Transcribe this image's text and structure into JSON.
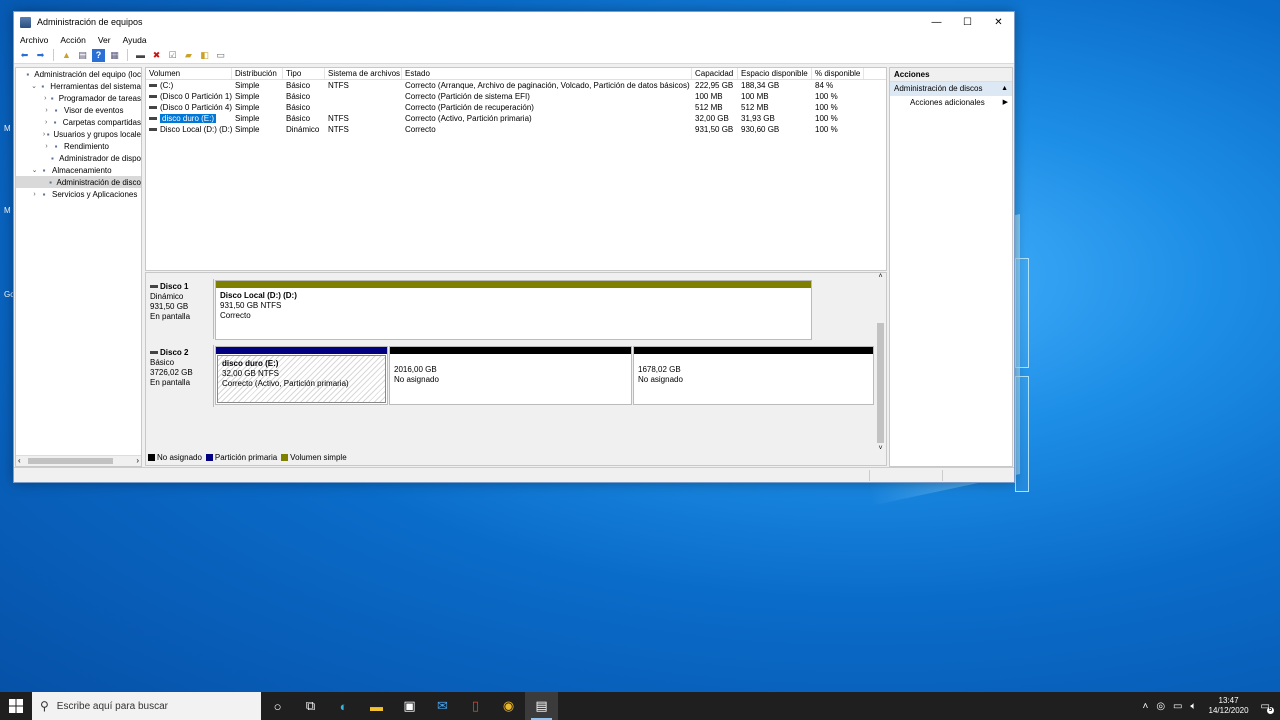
{
  "window": {
    "title": "Administración de equipos",
    "controls": {
      "minimize": "—",
      "maximize": "☐",
      "close": "✕"
    }
  },
  "menu": [
    "Archivo",
    "Acción",
    "Ver",
    "Ayuda"
  ],
  "tree": [
    {
      "label": "Administración del equipo (loc",
      "twisty": "",
      "level": 0,
      "icon": "computer-icon"
    },
    {
      "label": "Herramientas del sistema",
      "twisty": "⌄",
      "level": 1,
      "icon": "tools-icon"
    },
    {
      "label": "Programador de tareas",
      "twisty": "›",
      "level": 2,
      "icon": "clock-icon"
    },
    {
      "label": "Visor de eventos",
      "twisty": "›",
      "level": 2,
      "icon": "event-viewer-icon"
    },
    {
      "label": "Carpetas compartidas",
      "twisty": "›",
      "level": 2,
      "icon": "shared-folder-icon"
    },
    {
      "label": "Usuarios y grupos locale",
      "twisty": "›",
      "level": 2,
      "icon": "users-icon"
    },
    {
      "label": "Rendimiento",
      "twisty": "›",
      "level": 2,
      "icon": "performance-icon"
    },
    {
      "label": "Administrador de dispo",
      "twisty": "",
      "level": 2,
      "icon": "device-manager-icon"
    },
    {
      "label": "Almacenamiento",
      "twisty": "⌄",
      "level": 1,
      "icon": "storage-icon"
    },
    {
      "label": "Administración de disco",
      "twisty": "",
      "level": 2,
      "icon": "disk-icon",
      "selected": true
    },
    {
      "label": "Servicios y Aplicaciones",
      "twisty": "›",
      "level": 1,
      "icon": "services-icon"
    }
  ],
  "volumes": {
    "headers": [
      "Volumen",
      "Distribución",
      "Tipo",
      "Sistema de archivos",
      "Estado",
      "Capacidad",
      "Espacio disponible",
      "% disponible"
    ],
    "rows": [
      [
        "(C:)",
        "Simple",
        "Básico",
        "NTFS",
        "Correcto (Arranque, Archivo de paginación, Volcado, Partición de datos básicos)",
        "222,95 GB",
        "188,34 GB",
        "84 %"
      ],
      [
        "(Disco 0 Partición 1)",
        "Simple",
        "Básico",
        "",
        "Correcto (Partición de sistema EFI)",
        "100 MB",
        "100 MB",
        "100 %"
      ],
      [
        "(Disco 0 Partición 4)",
        "Simple",
        "Básico",
        "",
        "Correcto (Partición de recuperación)",
        "512 MB",
        "512 MB",
        "100 %"
      ],
      [
        "disco duro (E:)",
        "Simple",
        "Básico",
        "NTFS",
        "Correcto (Activo, Partición primaria)",
        "32,00 GB",
        "31,93 GB",
        "100 %"
      ],
      [
        "Disco Local (D:) (D:)",
        "Simple",
        "Dinámico",
        "NTFS",
        "Correcto",
        "931,50 GB",
        "930,60 GB",
        "100 %"
      ]
    ],
    "selected_index": 3
  },
  "disks": [
    {
      "name": "Disco 1",
      "kind": "Dinámico",
      "size": "931,50 GB",
      "status": "En pantalla",
      "partitions": [
        {
          "title": "Disco Local (D:)  (D:)",
          "line2": "931,50 GB NTFS",
          "line3": "Correcto",
          "color": "#808000"
        }
      ]
    },
    {
      "name": "Disco 2",
      "kind": "Básico",
      "size": "3726,02 GB",
      "status": "En pantalla",
      "partitions": [
        {
          "title": "disco duro  (E:)",
          "line2": "32,00 GB NTFS",
          "line3": "Correcto (Activo, Partición primaria)",
          "color": "#000080"
        },
        {
          "title": "",
          "line2": "2016,00 GB",
          "line3": "No asignado",
          "color": "#000000"
        },
        {
          "title": "",
          "line2": "1678,02 GB",
          "line3": "No asignado",
          "color": "#000000"
        }
      ]
    }
  ],
  "legend": [
    {
      "label": "No asignado",
      "color": "#000000"
    },
    {
      "label": "Partición primaria",
      "color": "#000080"
    },
    {
      "label": "Volumen simple",
      "color": "#808000"
    }
  ],
  "actions": {
    "header": "Acciones",
    "section": "Administración de discos",
    "items": [
      "Acciones adicionales"
    ]
  },
  "taskbar": {
    "search_placeholder": "Escribe aquí para buscar",
    "time": "13:47",
    "date": "14/12/2020",
    "notification_count": "5"
  },
  "desktop": {
    "icon_labels": [
      "M",
      "M",
      "Go"
    ]
  }
}
